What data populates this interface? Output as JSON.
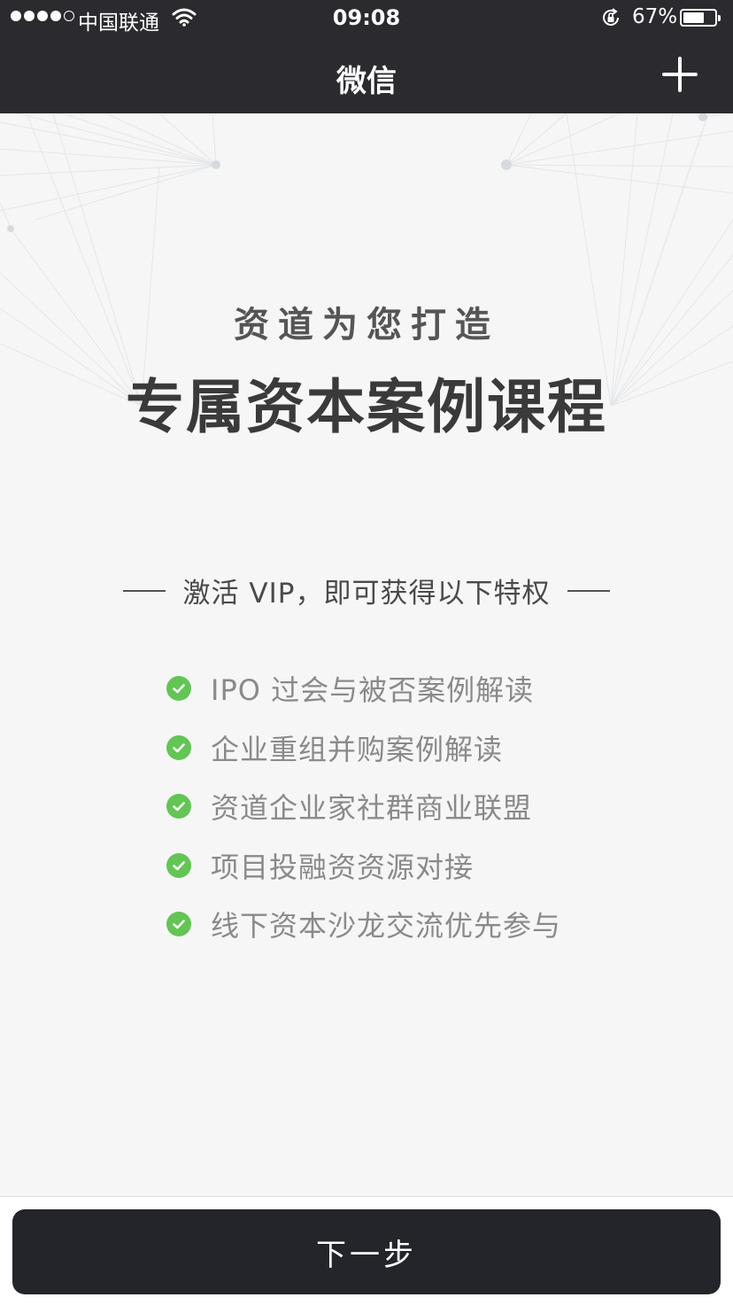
{
  "status_bar": {
    "carrier": "中国联通",
    "time": "09:08",
    "battery_percent_text": "67%",
    "battery_level": 0.67,
    "signal_bars_filled": 4,
    "signal_bars_total": 5
  },
  "nav": {
    "title": "微信",
    "add_icon": "plus-icon"
  },
  "hero": {
    "subtitle": "资道为您打造",
    "title": "专属资本案例课程"
  },
  "privileges": {
    "heading": "激活 VIP，即可获得以下特权",
    "items": [
      {
        "label": "IPO 过会与被否案例解读",
        "icon": "check-circle-icon"
      },
      {
        "label": "企业重组并购案例解读",
        "icon": "check-circle-icon"
      },
      {
        "label": "资道企业家社群商业联盟",
        "icon": "check-circle-icon"
      },
      {
        "label": "项目投融资资源对接",
        "icon": "check-circle-icon"
      },
      {
        "label": "线下资本沙龙交流优先参与",
        "icon": "check-circle-icon"
      }
    ]
  },
  "footer": {
    "next_label": "下一步"
  },
  "colors": {
    "nav_background": "#2b2b2f",
    "page_background": "#f6f6f6",
    "check_green": "#62c554",
    "button_background": "#23252b"
  }
}
